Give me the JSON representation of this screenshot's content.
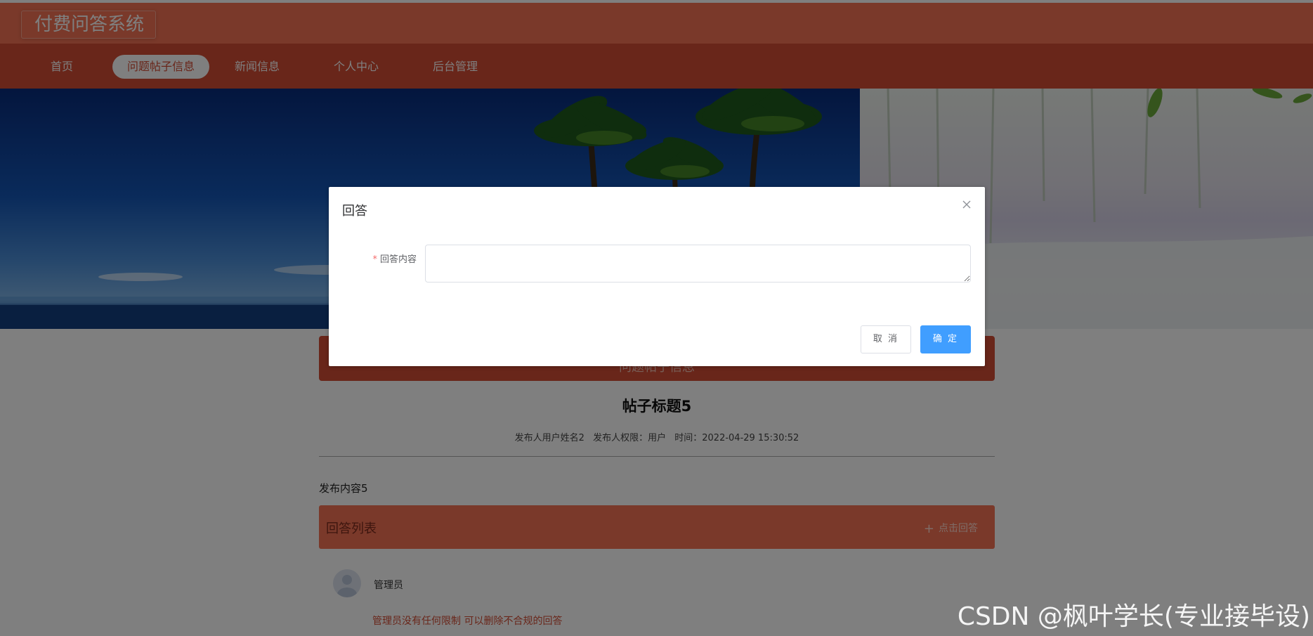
{
  "app": {
    "title": "付费问答系统"
  },
  "nav": {
    "items": [
      {
        "label": "首页"
      },
      {
        "label": "问题帖子信息",
        "active": true
      },
      {
        "label": "新闻信息"
      },
      {
        "label": "个人中心"
      },
      {
        "label": "后台管理"
      }
    ]
  },
  "content": {
    "header": "问题帖子信息",
    "post_title": "帖子标题5",
    "meta": {
      "author": "发布人用户姓名2",
      "permission": "发布人权限：用户",
      "time": "时间：2022-04-29 15:30:52"
    },
    "body": "发布内容5",
    "answers_title": "回答列表",
    "add_answer": "点击回答",
    "answers": [
      {
        "user": "管理员",
        "text": "管理员没有任何限制 可以删除不合规的回答"
      }
    ]
  },
  "modal": {
    "title": "回答",
    "field_label": "回答内容",
    "field_required_mark": "*",
    "field_value": "",
    "cancel_label": "取 消",
    "confirm_label": "确 定"
  },
  "watermark": "CSDN @枫叶学长(专业接毕设)",
  "colors": {
    "topbar": "#f47355",
    "navbar": "#d34c34",
    "primary_button": "#409eff",
    "required": "#f56c6c"
  },
  "icons": {
    "close": "close-icon",
    "plus": "plus-icon",
    "avatar": "user-avatar-icon"
  }
}
